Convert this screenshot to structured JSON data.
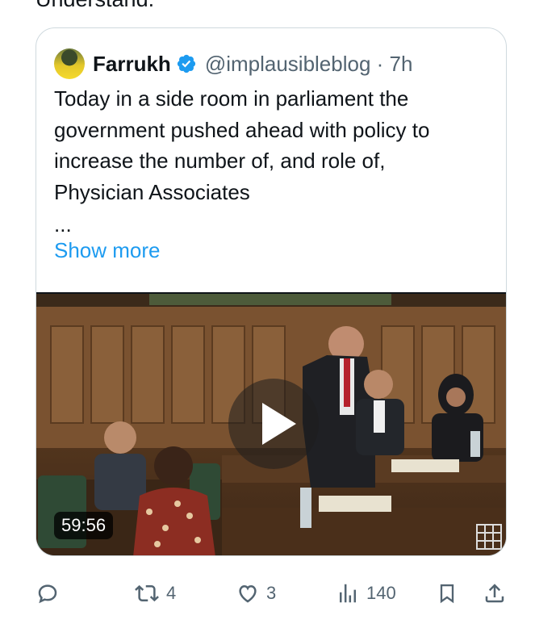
{
  "previous_text": "Understand.",
  "quoted_tweet": {
    "author_name": "Farrukh",
    "verified": true,
    "handle_time": "@implausibleblog · 7h",
    "text_lines": [
      "Today in a side room in parliament the",
      "government pushed ahead with policy to",
      "increase the number of, and role of,",
      "Physician Associates"
    ],
    "ellipsis": "...",
    "show_more_label": "Show more",
    "media": {
      "type": "video",
      "duration": "59:56"
    }
  },
  "actions": {
    "reply": {
      "icon": "reply-icon",
      "count": ""
    },
    "retweet": {
      "icon": "retweet-icon",
      "count": "4"
    },
    "like": {
      "icon": "heart-icon",
      "count": "3"
    },
    "views": {
      "icon": "views-icon",
      "count": "140"
    },
    "bookmark": {
      "icon": "bookmark-icon"
    },
    "share": {
      "icon": "share-icon"
    }
  },
  "colors": {
    "accent": "#1d9bf0",
    "muted": "#536471",
    "border": "#cfd9de"
  }
}
